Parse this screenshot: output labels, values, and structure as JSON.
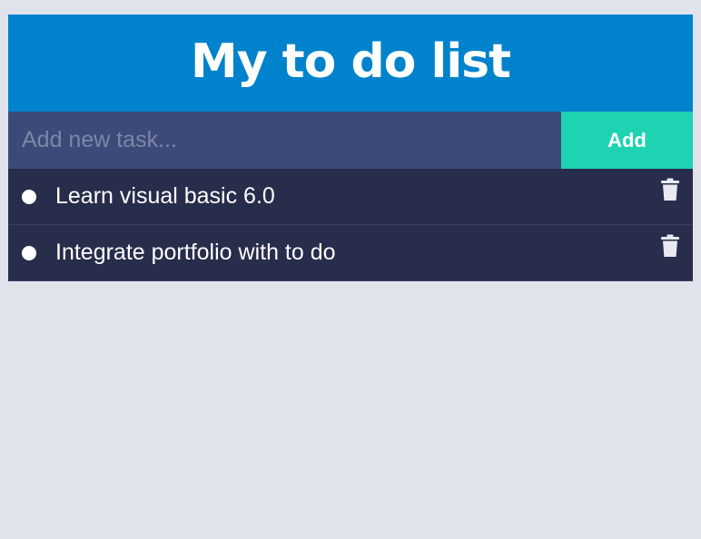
{
  "header": {
    "title": "My to do list"
  },
  "add_task": {
    "placeholder": "Add new task...",
    "value": "",
    "button_label": "Add"
  },
  "tasks": [
    {
      "text": "Learn visual basic 6.0",
      "icon": "trash-icon"
    },
    {
      "text": "Integrate portfolio with to do",
      "icon": "trash-icon"
    }
  ],
  "colors": {
    "header_bg": "#0082cc",
    "input_bg": "#3c4a79",
    "add_button_bg": "#1ed3b1",
    "task_bg": "#272d4b",
    "page_bg": "#e0e3ec"
  }
}
